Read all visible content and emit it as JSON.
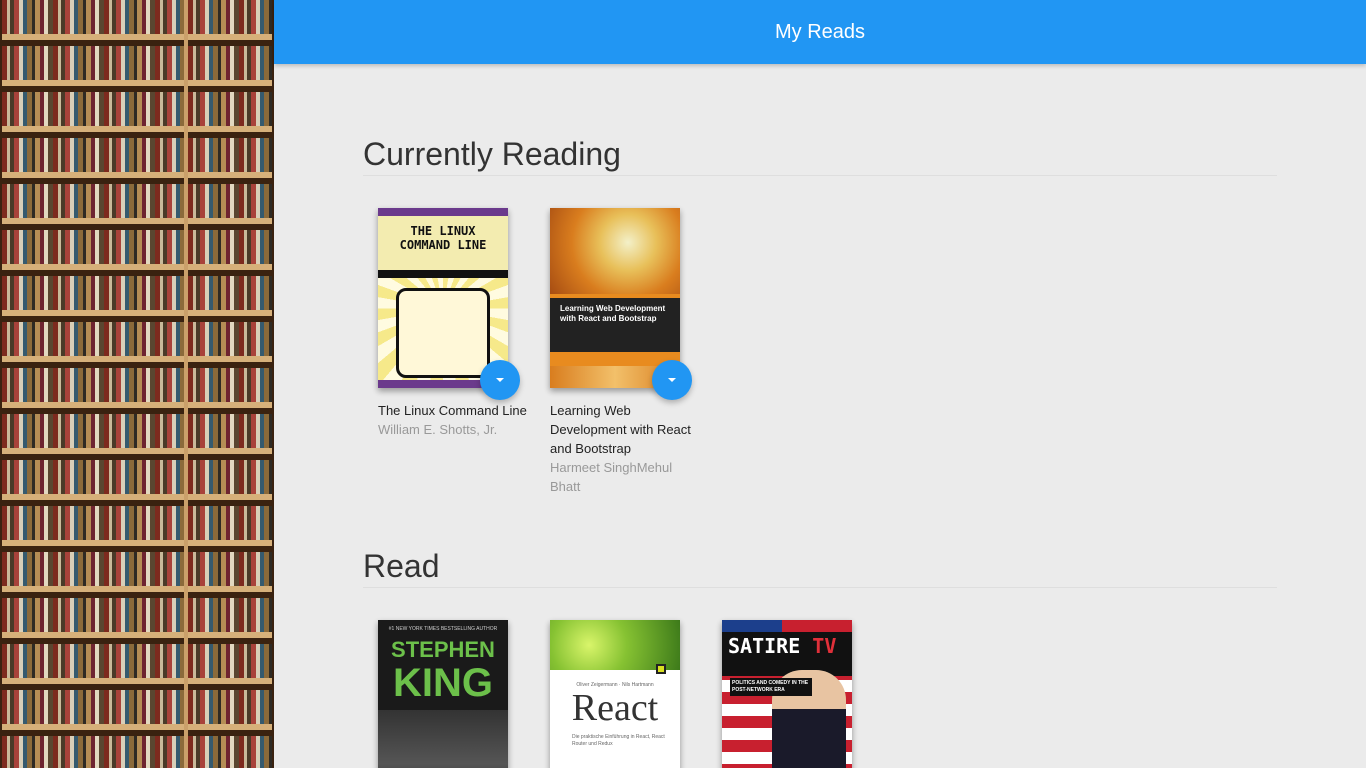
{
  "header": {
    "title": "My Reads"
  },
  "shelves": [
    {
      "title": "Currently Reading",
      "books": [
        {
          "title": "The Linux Command Line",
          "authors": "William E. Shotts, Jr.",
          "cover_text": "THE LINUX COMMAND LINE"
        },
        {
          "title": "Learning Web Development with React and Bootstrap",
          "authors": "Harmeet SinghMehul Bhatt",
          "cover_text": "Learning Web Development with React and Bootstrap"
        }
      ]
    },
    {
      "title": "Read",
      "books": [
        {
          "cover_top": "#1 NEW YORK TIMES BESTSELLING AUTHOR",
          "cover_name_1": "STEPHEN",
          "cover_name_2": "KING"
        },
        {
          "cover_authors": "Oliver Zeigermann · Nils Hartmann",
          "cover_word": "React",
          "cover_desc": "Die praktische Einführung in React, React Router und Redux"
        },
        {
          "cover_title": "SATIRE",
          "cover_tv": "TV",
          "cover_sub": "POLITICS AND COMEDY IN THE POST-NETWORK ERA"
        }
      ]
    }
  ],
  "colors": {
    "accent": "#2196f3",
    "background": "#ebebeb"
  }
}
